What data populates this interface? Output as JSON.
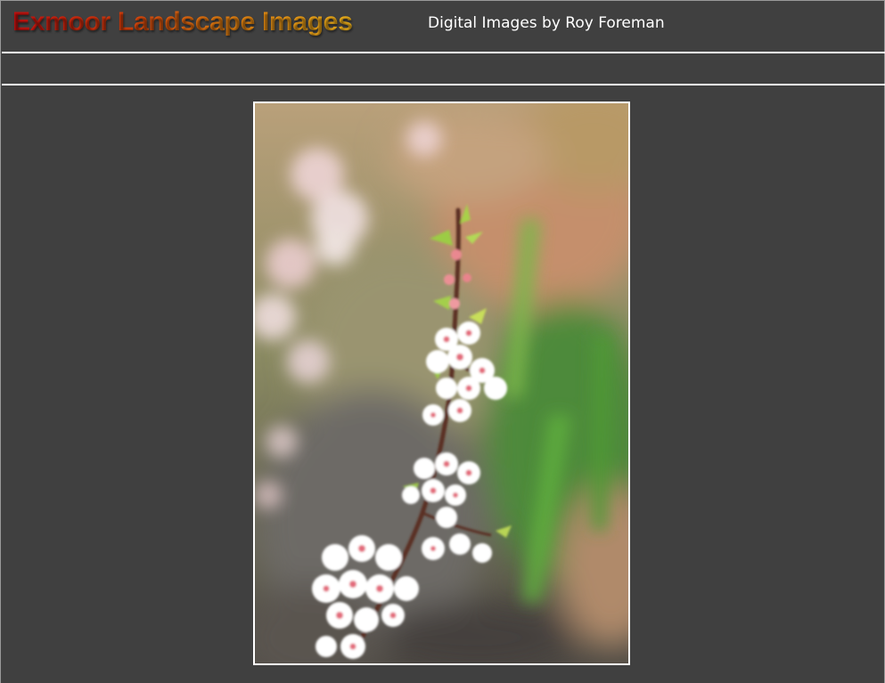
{
  "header": {
    "title": "Exmoor Landscape Images",
    "subtitle": "Digital Images by Roy Foreman"
  },
  "photo": {
    "description_alt": "Blossom branch photograph",
    "icon": "photo-image"
  },
  "colors": {
    "background": "#404040",
    "rule": "#ffffff",
    "title_gradient_start": "#c81010",
    "title_gradient_end": "#f0b41c",
    "subtitle": "#ffffff"
  }
}
